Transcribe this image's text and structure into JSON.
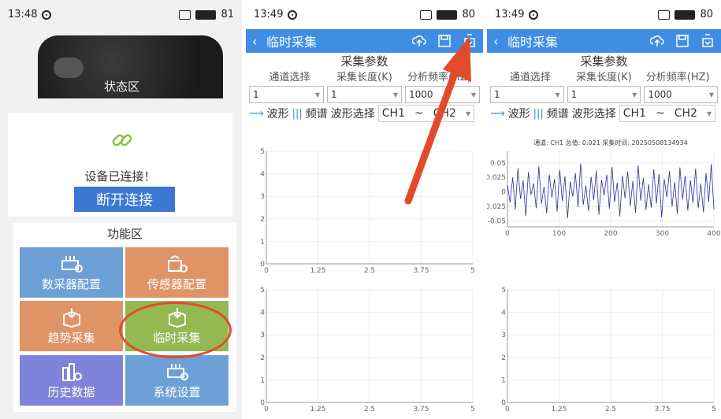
{
  "phone1": {
    "status_time": "13:48",
    "battery": "81",
    "device_label": "状态区",
    "connected_text": "设备已连接！",
    "disconnect_label": "断开连接",
    "function_title": "功能区",
    "tiles": [
      {
        "label": "数采器配置",
        "icon": "router-gear-icon",
        "color": "#6ea0d8"
      },
      {
        "label": "传感器配置",
        "icon": "sensor-gear-icon",
        "color": "#de9467"
      },
      {
        "label": "趋势采集",
        "icon": "box-download-icon",
        "color": "#de9467"
      },
      {
        "label": "临时采集",
        "icon": "box-download-icon",
        "color": "#94b852"
      },
      {
        "label": "历史数据",
        "icon": "history-chart-icon",
        "color": "#7f83d9"
      },
      {
        "label": "系统设置",
        "icon": "router-gear-icon",
        "color": "#6ea0d8"
      }
    ],
    "highlight_color": "#e34a2c"
  },
  "phone2": {
    "status_time": "13:49",
    "battery": "80",
    "title": "临时采集",
    "section_title": "采集参数",
    "params": [
      "通道选择",
      "采集长度(K)",
      "分析频率(HZ)"
    ],
    "values": [
      "1",
      "1",
      "1000"
    ],
    "wave_tab": "波形",
    "spectrum_tab": "频谱",
    "wave_select_label": "波形选择",
    "wave_channels": [
      "CH1",
      "~",
      "CH2"
    ],
    "chart_data": [
      {
        "type": "line",
        "x_ticks": [
          "0",
          "1.25",
          "2.5",
          "3.75",
          "5"
        ],
        "y_ticks": [
          "0",
          "1",
          "2",
          "3",
          "4",
          "5"
        ],
        "xlim": [
          0,
          5
        ],
        "ylim": [
          0,
          5
        ],
        "series": []
      },
      {
        "type": "line",
        "x_ticks": [
          "0",
          "1.25",
          "2.5",
          "3.75",
          "5"
        ],
        "y_ticks": [
          "0",
          "1",
          "2",
          "3",
          "4",
          "5"
        ],
        "xlim": [
          0,
          5
        ],
        "ylim": [
          0,
          5
        ],
        "series": []
      }
    ]
  },
  "phone3": {
    "status_time": "13:49",
    "battery": "80",
    "title": "临时采集",
    "section_title": "采集参数",
    "params": [
      "通道选择",
      "采集长度(K)",
      "分析频率(HZ)"
    ],
    "values": [
      "1",
      "1",
      "1000"
    ],
    "wave_tab": "波形",
    "spectrum_tab": "频谱",
    "wave_select_label": "波形选择",
    "wave_channels": [
      "CH1",
      "~",
      "CH2"
    ],
    "chart_data": [
      {
        "type": "line",
        "title": "通道: CH1 总值: 0.021 采集时间: 20250508134934",
        "x_ticks": [
          "0",
          "100",
          "200",
          "300",
          "400"
        ],
        "y_ticks": [
          "-0.05",
          "-0.025",
          "0",
          "0.025",
          "0.05"
        ],
        "xlim": [
          0,
          400
        ],
        "ylim": [
          -0.06,
          0.07
        ],
        "series": [
          {
            "color": "#2b2f9f",
            "values": [
              0.012,
              -0.018,
              0.025,
              -0.03,
              0.041,
              -0.012,
              0.02,
              -0.041,
              0.034,
              -0.005,
              0.015,
              -0.028,
              0.044,
              -0.02,
              0.009,
              -0.037,
              0.03,
              -0.01,
              0.022,
              -0.034,
              0.038,
              -0.016,
              0.027,
              -0.045,
              0.018,
              -0.008,
              0.032,
              -0.026,
              0.049,
              -0.022,
              0.011,
              -0.033,
              0.026,
              -0.014,
              0.037,
              -0.039,
              0.021,
              -0.006,
              0.03,
              -0.029,
              0.043,
              -0.018,
              0.016,
              -0.042,
              0.028,
              -0.011,
              0.035,
              -0.024,
              0.019,
              -0.036,
              0.046,
              -0.015,
              0.024,
              -0.031,
              0.013,
              -0.027,
              0.039,
              -0.02,
              0.031,
              -0.044,
              0.022,
              -0.009,
              0.036,
              -0.025,
              0.017,
              -0.038,
              0.042,
              -0.013,
              0.028,
              -0.032,
              0.02,
              -0.019,
              0.04,
              -0.028,
              0.014,
              -0.035,
              0.033,
              -0.017,
              0.048,
              -0.03
            ]
          }
        ]
      },
      {
        "type": "line",
        "x_ticks": [
          "0",
          "1.25",
          "2.5",
          "3.75",
          "5"
        ],
        "y_ticks": [
          "0",
          "1",
          "2",
          "3",
          "4",
          "5"
        ],
        "xlim": [
          0,
          5
        ],
        "ylim": [
          0,
          5
        ],
        "series": []
      }
    ]
  },
  "arrow_color": "#e34a2c"
}
